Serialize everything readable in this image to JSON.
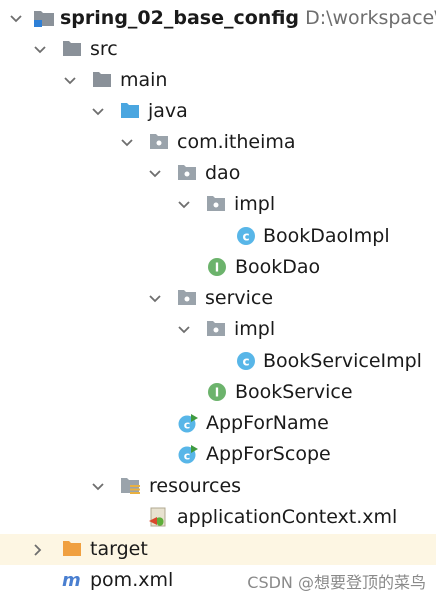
{
  "project": {
    "name": "spring_02_base_config",
    "path": "D:\\workspace\\"
  },
  "nodes": {
    "src": "src",
    "main": "main",
    "java": "java",
    "package": "com.itheima",
    "dao": "dao",
    "dao_impl": "impl",
    "book_dao_impl": "BookDaoImpl",
    "book_dao": "BookDao",
    "service": "service",
    "service_impl": "impl",
    "book_service_impl": "BookServiceImpl",
    "book_service": "BookService",
    "app_for_name": "AppForName",
    "app_for_scope": "AppForScope",
    "resources": "resources",
    "application_context": "applicationContext.xml",
    "target": "target",
    "pom": "pom.xml"
  },
  "icons": {
    "module_folder": "module-folder-icon",
    "folder": "folder-icon",
    "source_folder": "source-folder-icon",
    "package": "package-icon",
    "class": "class-icon",
    "interface": "interface-icon",
    "runnable_class": "runnable-class-icon",
    "resources_folder": "resources-folder-icon",
    "xml_file": "spring-xml-file-icon",
    "excluded_folder": "excluded-folder-icon",
    "maven_file": "maven-icon"
  },
  "colors": {
    "folder": "#8a9199",
    "source_folder": "#4aa6e0",
    "package": "#9aa3ab",
    "class_circle": "#58b6e8",
    "interface_circle": "#6cb36c",
    "excluded_folder": "#f0a040",
    "highlight_row": "#fdf6e3"
  },
  "watermark": "CSDN @想要登顶的菜鸟"
}
